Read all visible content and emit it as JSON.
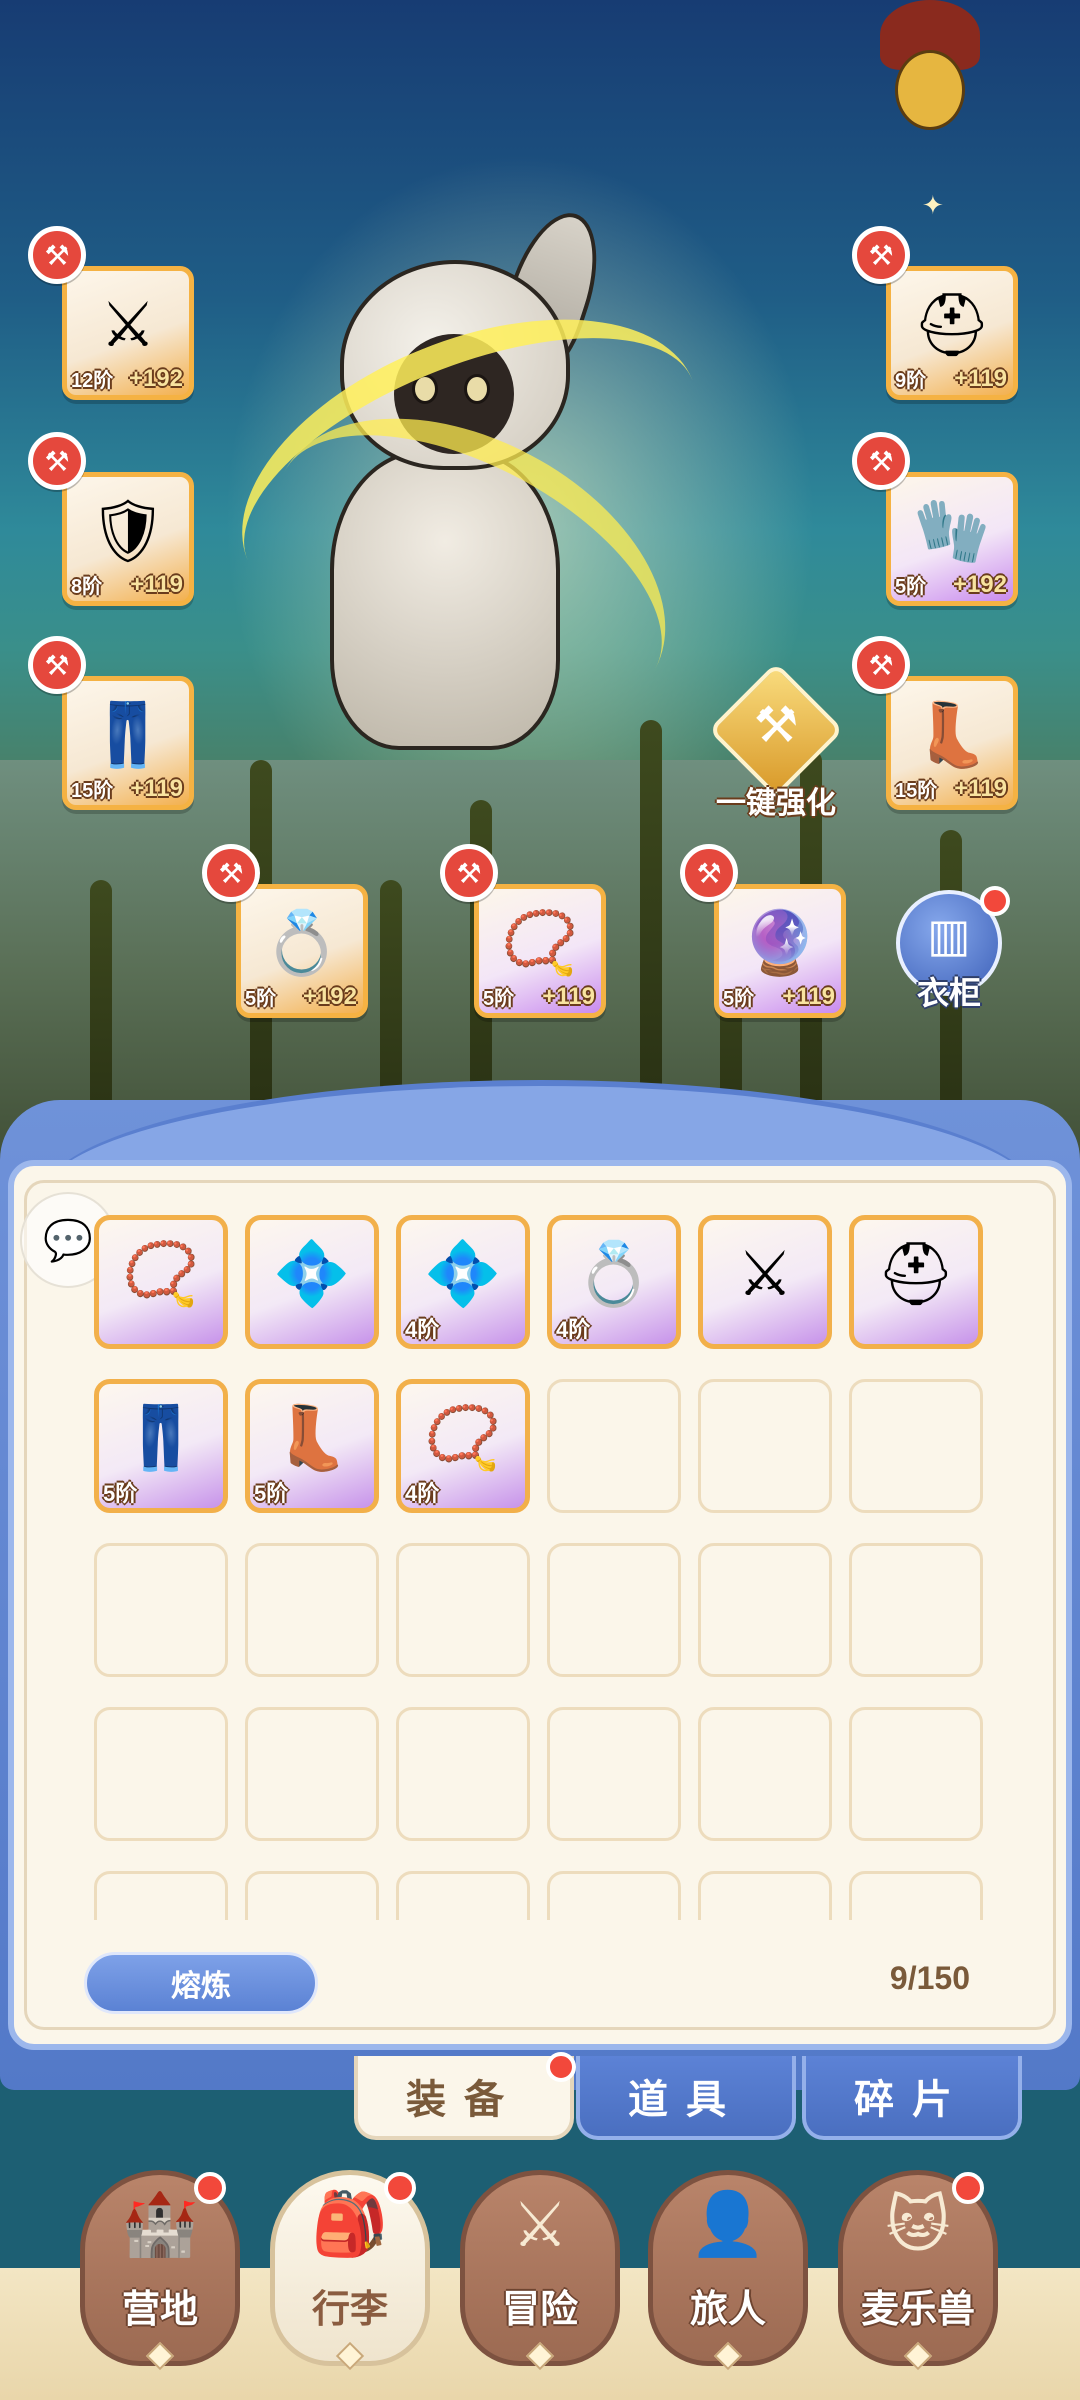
{
  "equipment_slots": [
    {
      "id": "weapon",
      "tier": "12阶",
      "bonus": "+192",
      "icon": "⚔",
      "color": "orange"
    },
    {
      "id": "helmet",
      "tier": "9阶",
      "bonus": "+119",
      "icon": "⛑",
      "color": "orange"
    },
    {
      "id": "armor",
      "tier": "8阶",
      "bonus": "+119",
      "icon": "🛡",
      "color": "orange"
    },
    {
      "id": "gloves",
      "tier": "5阶",
      "bonus": "+192",
      "icon": "🧤",
      "color": "purple"
    },
    {
      "id": "pants",
      "tier": "15阶",
      "bonus": "+119",
      "icon": "👖",
      "color": "orange"
    },
    {
      "id": "boots",
      "tier": "15阶",
      "bonus": "+119",
      "icon": "👢",
      "color": "orange"
    },
    {
      "id": "ring",
      "tier": "5阶",
      "bonus": "+192",
      "icon": "💍",
      "color": "orange"
    },
    {
      "id": "necklace",
      "tier": "5阶",
      "bonus": "+119",
      "icon": "📿",
      "color": "purple"
    },
    {
      "id": "charm",
      "tier": "5阶",
      "bonus": "+119",
      "icon": "🔮",
      "color": "purple"
    }
  ],
  "hammer_icon": "⚒",
  "one_key_enhance": {
    "label": "一键强化",
    "icon": "anvil-icon"
  },
  "wardrobe": {
    "label": "衣柜",
    "icon": "wardrobe-icon"
  },
  "inventory": {
    "items": [
      {
        "icon": "📿",
        "tier": ""
      },
      {
        "icon": "💠",
        "tier": ""
      },
      {
        "icon": "💠",
        "tier": "4阶"
      },
      {
        "icon": "💍",
        "tier": "4阶"
      },
      {
        "icon": "⚔",
        "tier": ""
      },
      {
        "icon": "⛑",
        "tier": ""
      },
      {
        "icon": "👖",
        "tier": "5阶"
      },
      {
        "icon": "👢",
        "tier": "5阶"
      },
      {
        "icon": "📿",
        "tier": "4阶"
      }
    ],
    "capacity": "9/150",
    "smelt_label": "熔炼"
  },
  "sub_tabs": [
    {
      "label": "装备",
      "active": true,
      "badge": true
    },
    {
      "label": "道具",
      "active": false,
      "badge": false
    },
    {
      "label": "碎片",
      "active": false,
      "badge": false
    }
  ],
  "bottom_nav": [
    {
      "label": "营地",
      "icon": "castle-icon",
      "glyph": "🏰",
      "active": false,
      "badge": true
    },
    {
      "label": "行李",
      "icon": "backpack-icon",
      "glyph": "🎒",
      "active": true,
      "badge": true
    },
    {
      "label": "冒险",
      "icon": "crossed-swords-icon",
      "glyph": "⚔",
      "active": false,
      "badge": false
    },
    {
      "label": "旅人",
      "icon": "traveler-icon",
      "glyph": "👤",
      "active": false,
      "badge": false
    },
    {
      "label": "麦乐兽",
      "icon": "pet-icon",
      "glyph": "🐱",
      "active": false,
      "badge": true
    }
  ],
  "colors": {
    "slot_border": "#f5b243",
    "panel_blue": "#5b82d4",
    "badge_red": "#e5483d"
  }
}
